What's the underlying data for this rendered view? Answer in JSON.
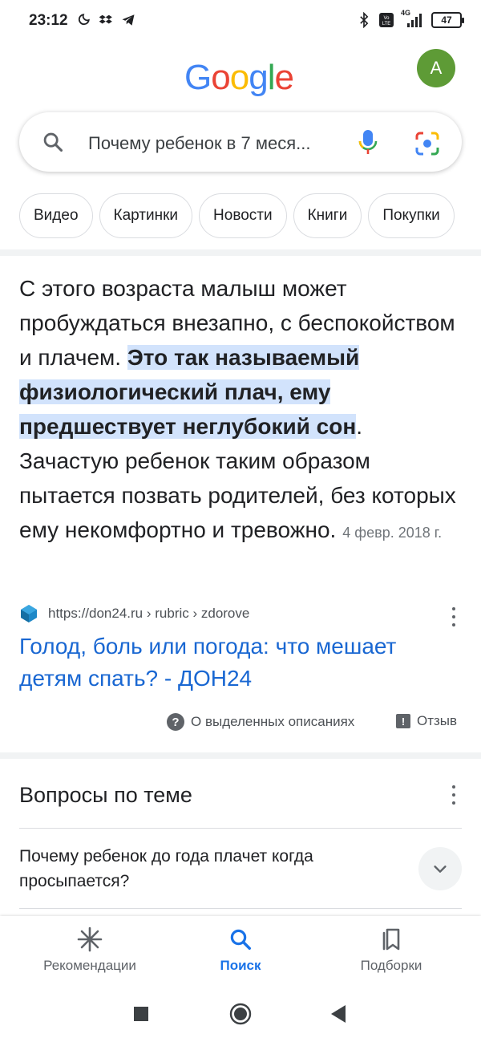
{
  "status_bar": {
    "time": "23:12",
    "left_icons": [
      "moon-icon",
      "dropbox-icon",
      "telegram-icon"
    ],
    "right_icons": [
      "bluetooth-icon",
      "volte-icon",
      "signal-4g-icon"
    ],
    "network_label": "4G",
    "battery": "47"
  },
  "header": {
    "logo_letters": [
      "G",
      "o",
      "o",
      "g",
      "l",
      "e"
    ],
    "logo_colors": [
      "#4285F4",
      "#EA4335",
      "#FBBC05",
      "#4285F4",
      "#34A853",
      "#EA4335"
    ],
    "avatar_letter": "A",
    "avatar_color": "#5e9b36"
  },
  "search": {
    "query": "Почему ребенок в 7 меся..."
  },
  "chips": [
    "Видео",
    "Картинки",
    "Новости",
    "Книги",
    "Покупки"
  ],
  "snippet": {
    "text_before": "С этого возраста малыш может пробуждаться внезапно, с беспокойством и плачем. ",
    "text_highlight": "Это так называемый физиологический плач, ему предшествует неглубокий сон",
    "text_after": ". Зачастую ребенок таким образом пытается позвать родителей, без которых ему некомфортно и тревожно.",
    "date": "4 февр. 2018 г.",
    "source_url": "https://don24.ru › rubric › zdorove",
    "result_title": "Голод, боль или погода: что мешает детям спать? - ДОН24",
    "about_label": "О выделенных описаниях",
    "feedback_label": "Отзыв"
  },
  "related_questions": {
    "heading": "Вопросы по теме",
    "items": [
      "Почему ребенок до года плачет когда просыпается?"
    ]
  },
  "bottom_nav": {
    "items": [
      {
        "label": "Рекомендации",
        "icon": "sparkle-icon",
        "active": false
      },
      {
        "label": "Поиск",
        "icon": "search-icon",
        "active": true
      },
      {
        "label": "Подборки",
        "icon": "collections-icon",
        "active": false
      }
    ]
  },
  "system_nav": [
    "recents-button",
    "home-button",
    "back-button"
  ],
  "colors": {
    "link": "#1967d2",
    "highlight": "#d2e3fc",
    "active_nav": "#1a73e8"
  }
}
